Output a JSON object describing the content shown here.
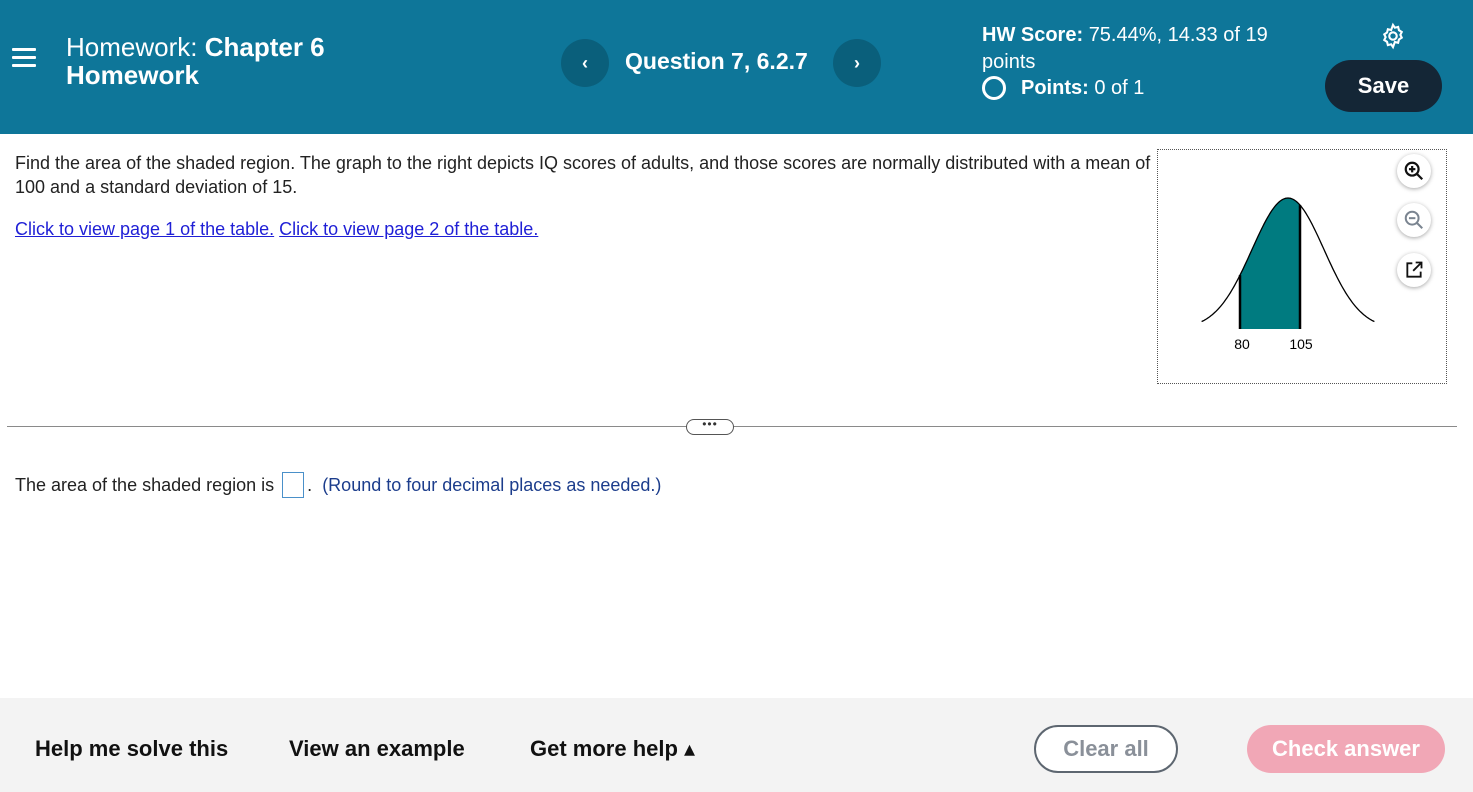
{
  "header": {
    "title_prefix": "Homework:",
    "title_bold": "Chapter 6 Homework",
    "question_label": "Question 7, 6.2.7",
    "prev_icon": "chevron-left-icon",
    "next_icon": "chevron-right-icon",
    "hw_score_label": "HW Score:",
    "hw_score_value": "75.44%, 14.33 of 19 points",
    "points_label": "Points:",
    "points_value": "0 of 1",
    "save_label": "Save",
    "background_color": "#0e7699",
    "save_color": "#142636"
  },
  "question": {
    "text": "Find the area of the shaded region. The graph to the right depicts IQ scores of adults, and those scores are normally distributed with a mean of 100 and a standard deviation of 15.",
    "link1": "Click to view page 1 of the table.",
    "link2": "Click to view page 2 of the table."
  },
  "graph": {
    "mean": 100,
    "sd": 15,
    "shade_from": 80,
    "shade_to": 105,
    "label_left": "80",
    "label_right": "105",
    "shade_color": "#007b80",
    "tools": [
      "zoom-in-icon",
      "zoom-out-icon",
      "pop-out-icon"
    ]
  },
  "answer": {
    "prefix": "The area of the shaded region is",
    "suffix": ".",
    "note": "(Round to four decimal places as needed.)",
    "value": ""
  },
  "footer": {
    "help_label": "Help me solve this",
    "example_label": "View an example",
    "more_help_label": "Get more help ▴",
    "clear_label": "Clear all",
    "check_label": "Check answer",
    "check_color": "#f1a7b6"
  }
}
